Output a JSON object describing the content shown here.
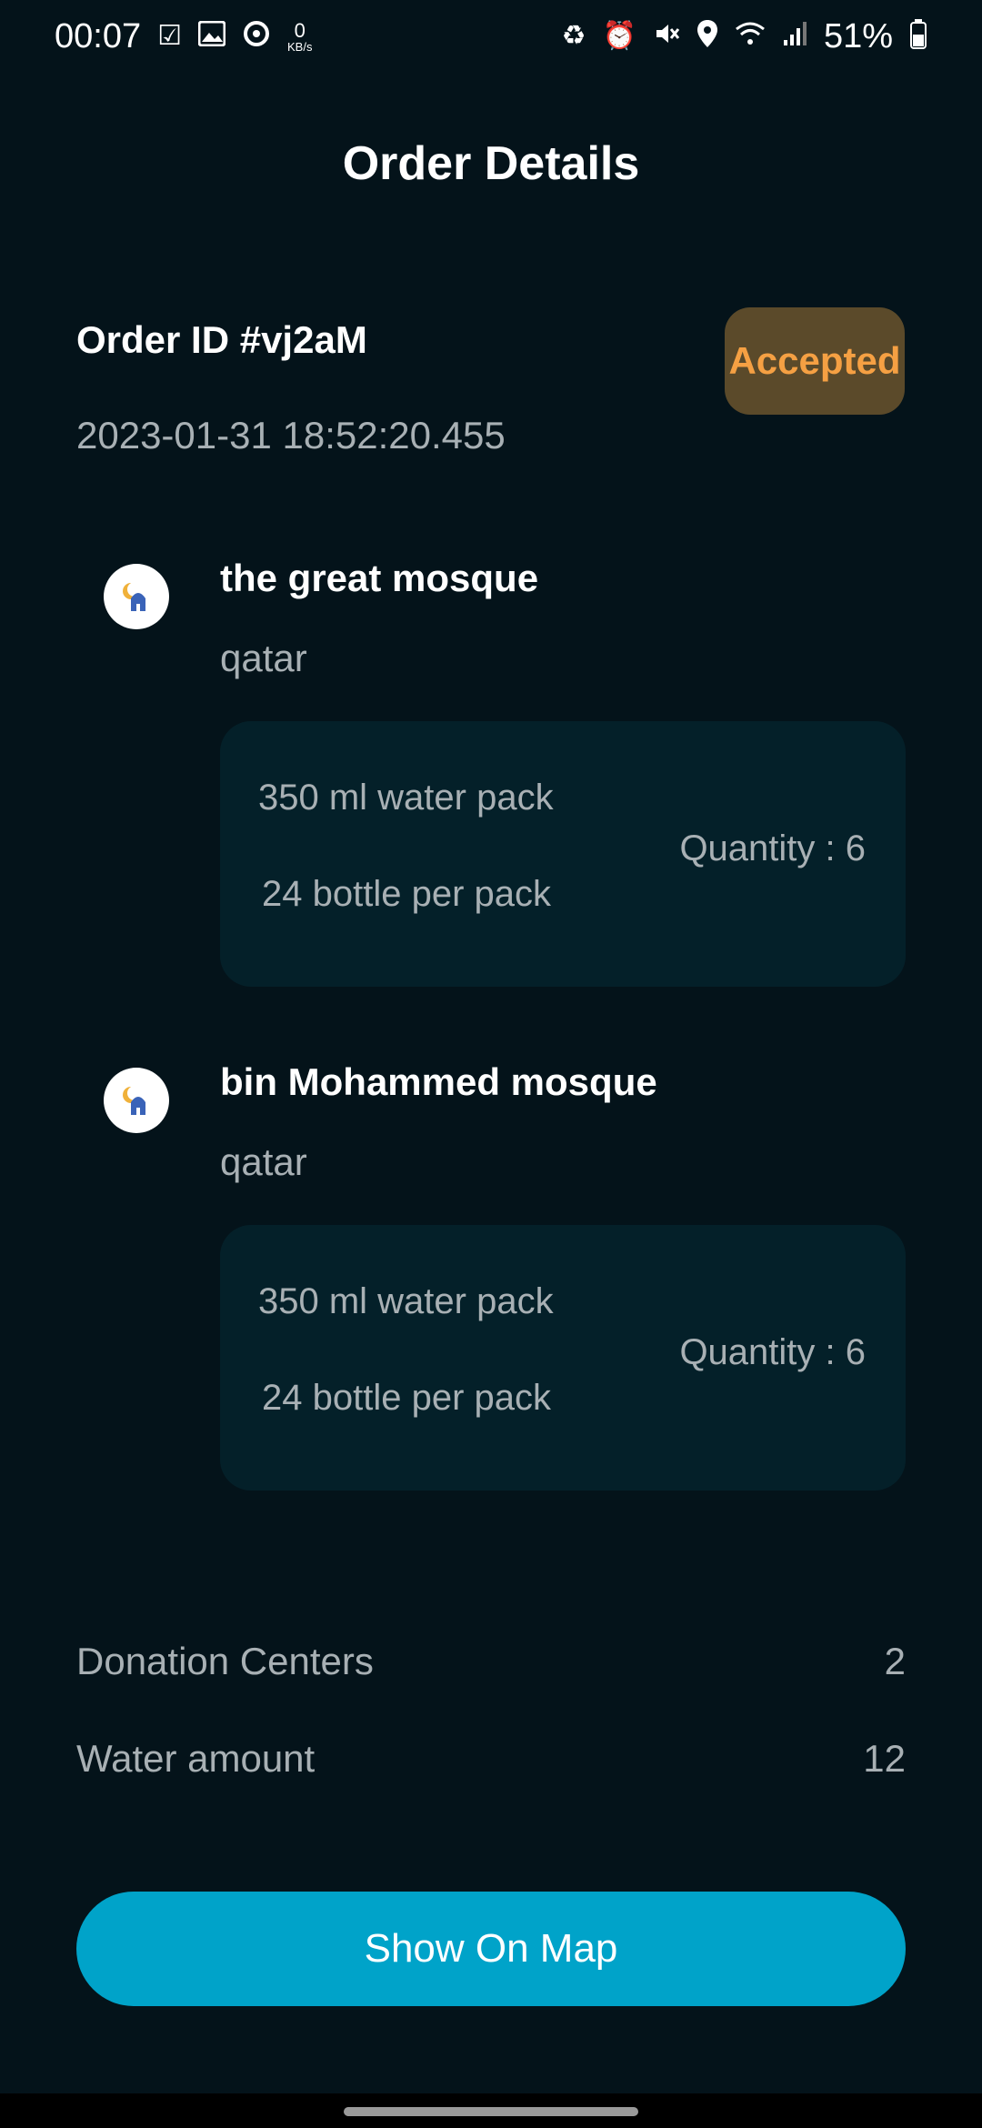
{
  "status_bar": {
    "time": "00:07",
    "net_speed_value": "0",
    "net_speed_unit": "KB/s",
    "battery_text": "51%",
    "icons": [
      "check-notification-icon",
      "image-notification-icon",
      "sync-icon",
      "recycle-icon",
      "alarm-icon",
      "mute-icon",
      "location-icon",
      "wifi-icon",
      "signal-icon",
      "battery-icon"
    ]
  },
  "header": {
    "title": "Order Details"
  },
  "order": {
    "id_text": "Order ID #vj2aM",
    "date": "2023-01-31 18:52:20.455",
    "status": "Accepted"
  },
  "centers": [
    {
      "name": "the great mosque",
      "country": "qatar",
      "item": {
        "name": "350 ml water pack",
        "pack": "24 bottle per pack",
        "quantity": "Quantity : 6"
      }
    },
    {
      "name": "bin Mohammed mosque",
      "country": "qatar",
      "item": {
        "name": "350 ml water pack",
        "pack": "24 bottle per pack",
        "quantity": "Quantity : 6"
      }
    }
  ],
  "summary": {
    "donation_centers_label": "Donation Centers",
    "donation_centers_value": "2",
    "water_amount_label": "Water amount",
    "water_amount_value": "12"
  },
  "actions": {
    "show_on_map": "Show On Map"
  },
  "colors": {
    "background": "#04131a",
    "card": "#042029",
    "accent": "#00a3c9",
    "status_bg": "#5b4a2a",
    "status_text": "#f5a043"
  }
}
